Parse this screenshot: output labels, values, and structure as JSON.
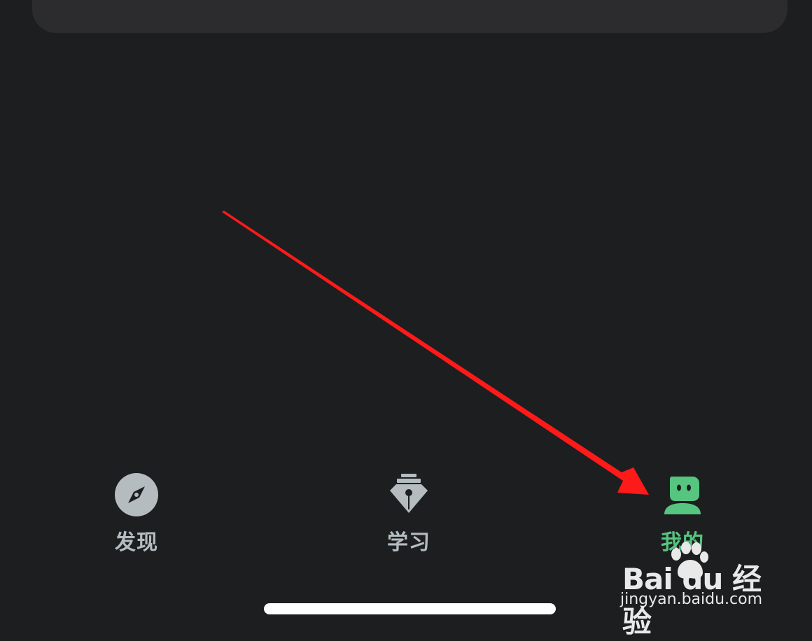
{
  "tabbar": {
    "tabs": [
      {
        "id": "discover",
        "label": "发现",
        "icon": "compass-icon",
        "active": false
      },
      {
        "id": "learn",
        "label": "学习",
        "icon": "pen-nib-icon",
        "active": false
      },
      {
        "id": "mine",
        "label": "我的",
        "icon": "profile-icon",
        "active": true
      }
    ]
  },
  "colors": {
    "background": "#1d1e20",
    "card": "#2c2c2e",
    "inactive": "#b4bcc0",
    "active": "#55c57f",
    "annotation": "#ff1a1a"
  },
  "watermark": {
    "logo_text": "Bai du 经验",
    "url": "jingyan.baidu.com"
  }
}
